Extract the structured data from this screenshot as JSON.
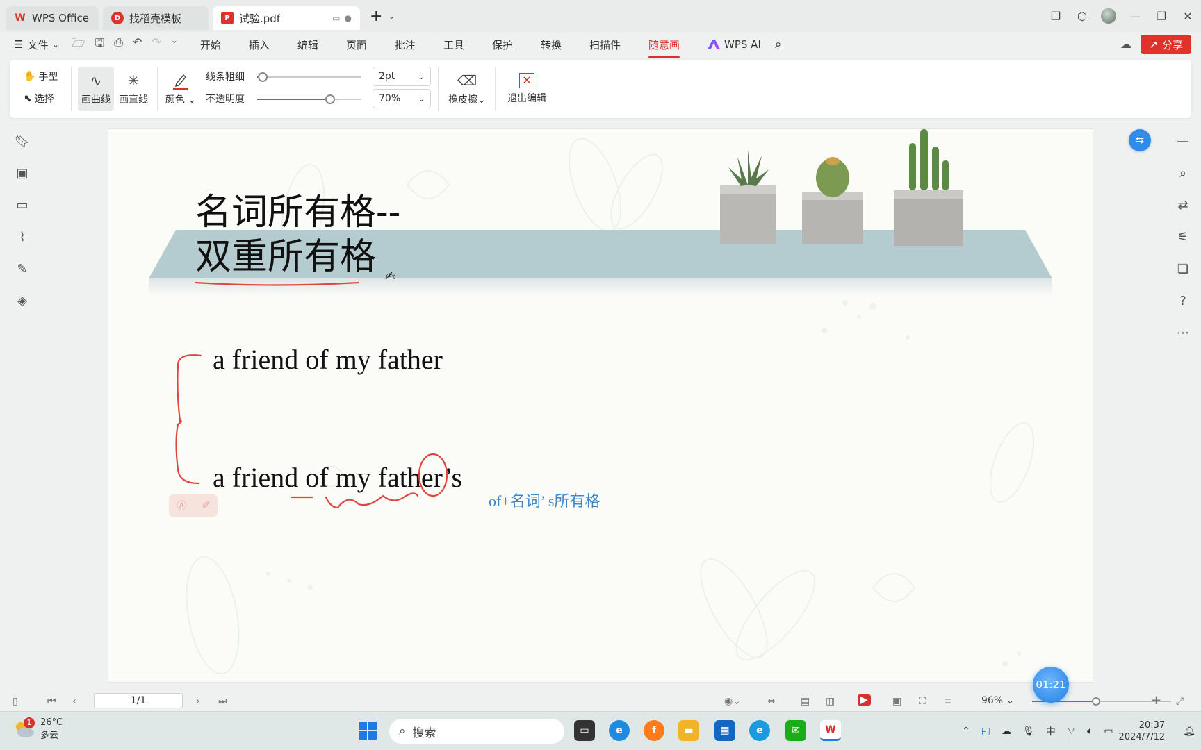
{
  "tabs": [
    {
      "label": "WPS Office",
      "icon": "wps-logo-icon"
    },
    {
      "label": "找稻壳模板",
      "icon": "docer-icon"
    },
    {
      "label": "试验.pdf",
      "icon": "pdf-icon"
    }
  ],
  "menubar": {
    "file": "文件",
    "items": [
      "开始",
      "插入",
      "编辑",
      "页面",
      "批注",
      "工具",
      "保护",
      "转换",
      "扫描件",
      "随意画"
    ],
    "active": "随意画",
    "wps_ai": "WPS AI",
    "share": "分享"
  },
  "ribbon": {
    "hand": "手型",
    "select": "选择",
    "draw_curve": "画曲线",
    "draw_line": "画直线",
    "color": "颜色",
    "stroke_width_label": "线条粗细",
    "opacity_label": "不透明度",
    "stroke_width_value": "2pt",
    "opacity_value": "70%",
    "stroke_width_level": 0.05,
    "opacity_level": 0.7,
    "eraser": "橡皮擦",
    "exit_edit": "退出编辑",
    "pen_color": "#d9312b"
  },
  "slide": {
    "title_line1": "名词所有格--",
    "title_line2": "双重所有格",
    "line1": "a friend of my father",
    "line2": "a friend of my father’s",
    "annotation": "of+名词’ s所有格"
  },
  "statusbar": {
    "page": "1/1",
    "zoom": "96%",
    "timer": "01:21"
  },
  "taskbar": {
    "temperature": "26°C",
    "weather": "多云",
    "notification_count": "1",
    "search": "搜索",
    "time": "20:37",
    "date": "2024/7/12",
    "ime": "中"
  },
  "colors": {
    "accent": "#d9312b",
    "ink": "#e0463c",
    "annotation": "#3f86c4",
    "banner": "#b4cbcf"
  }
}
